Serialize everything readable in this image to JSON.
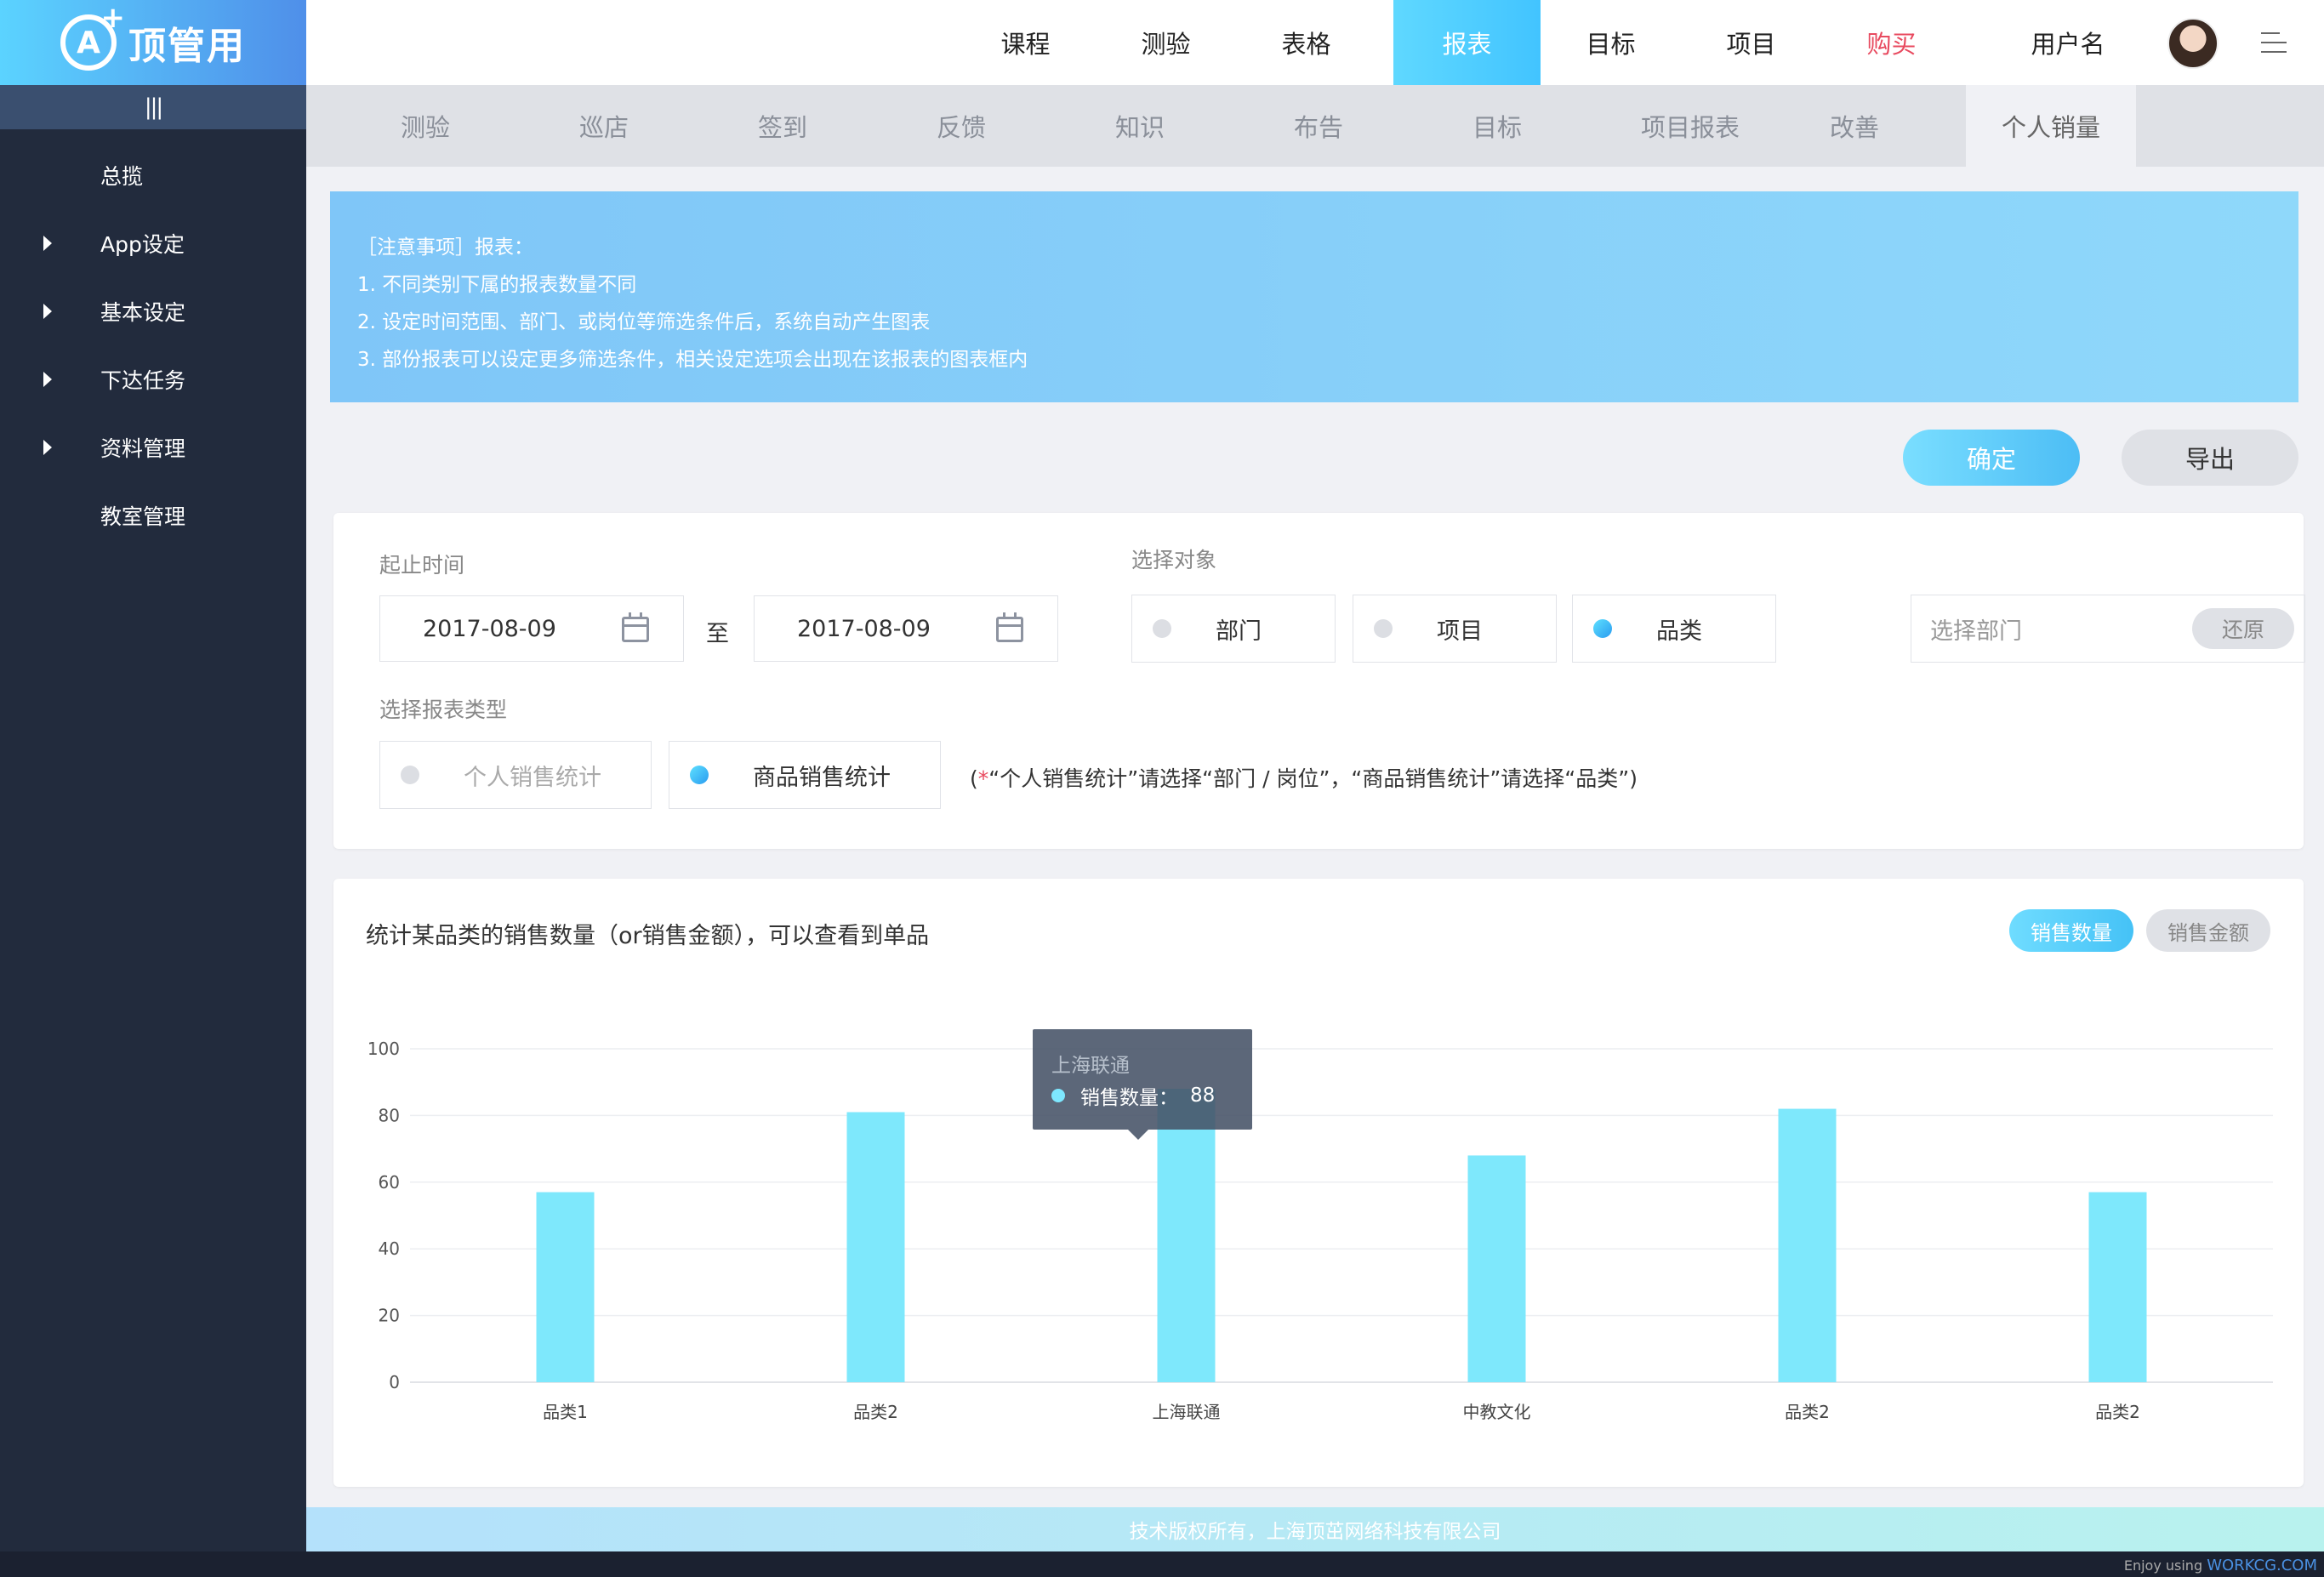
{
  "brand": {
    "logo_mark": "A",
    "name": "顶管用"
  },
  "sidebar": {
    "collapse_label": "|||",
    "items": [
      {
        "label": "总揽",
        "expandable": false
      },
      {
        "label": "App设定",
        "expandable": true
      },
      {
        "label": "基本设定",
        "expandable": true
      },
      {
        "label": "下达任务",
        "expandable": true
      },
      {
        "label": "资料管理",
        "expandable": true
      },
      {
        "label": "教室管理",
        "expandable": false
      }
    ]
  },
  "topnav": {
    "tabs": [
      "课程",
      "测验",
      "表格",
      "报表",
      "目标",
      "项目",
      "购买"
    ],
    "active": "报表",
    "username": "用户名"
  },
  "subnav": {
    "tabs": [
      "测验",
      "巡店",
      "签到",
      "反馈",
      "知识",
      "布告",
      "目标",
      "项目报表",
      "改善",
      "个人销量"
    ],
    "active": "个人销量"
  },
  "notice": {
    "title": "［注意事项］报表：",
    "lines": [
      "1. 不同类别下属的报表数量不同",
      "2. 设定时间范围、部门、或岗位等筛选条件后，系统自动产生图表",
      "3. 部份报表可以设定更多筛选条件，相关设定选项会出现在该报表的图表框内"
    ]
  },
  "actions": {
    "confirm": "确定",
    "export": "导出"
  },
  "filter": {
    "date_label": "起止时间",
    "start_date": "2017-08-09",
    "to_label": "至",
    "end_date": "2017-08-09",
    "target_label": "选择对象",
    "targets": [
      {
        "label": "部门",
        "selected": false
      },
      {
        "label": "项目",
        "selected": false
      },
      {
        "label": "品类",
        "selected": true
      }
    ],
    "dept_placeholder": "选择部门",
    "reset": "还原",
    "type_label": "选择报表类型",
    "types": [
      {
        "label": "个人销售统计",
        "selected": false
      },
      {
        "label": "商品销售统计",
        "selected": true
      }
    ],
    "hint_open": "(",
    "hint_star": "*",
    "hint_text": "“个人销售统计”请选择“部门 / 岗位”，“商品销售统计”请选择“品类”)"
  },
  "chart_panel": {
    "title": "统计某品类的销售数量（or销售金额），可以查看到单品",
    "toggle_qty": "销售数量",
    "toggle_amt": "销售金额",
    "tooltip": {
      "title": "上海联通",
      "series": "销售数量：",
      "value": "88"
    }
  },
  "chart_data": {
    "type": "bar",
    "categories": [
      "品类1",
      "品类2",
      "上海联通",
      "中教文化",
      "品类2",
      "品类2"
    ],
    "values": [
      57,
      81,
      88,
      68,
      82,
      57
    ],
    "ylim": [
      0,
      100
    ],
    "yticks": [
      0,
      20,
      40,
      60,
      80,
      100
    ],
    "bar_color": "#7ee8fc",
    "grid": true
  },
  "footer": {
    "text": "技术版权所有，上海顶茁网络科技有限公司"
  },
  "credit": {
    "prefix": "Enjoy using",
    "site": "WORKCG.COM"
  },
  "colors": {
    "accent": "#45c2f6",
    "sidebar_bg": "#222b3d",
    "buy": "#e84a5f"
  }
}
